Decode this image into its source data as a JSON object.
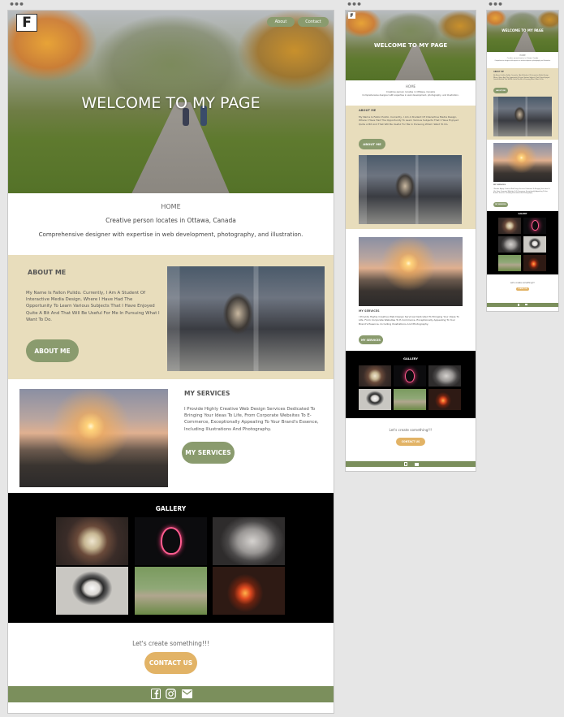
{
  "site": {
    "logo_letter": "F",
    "hero_title": "WELCOME TO MY PAGE",
    "nav": [
      {
        "label": "About"
      },
      {
        "label": "Contact"
      }
    ],
    "home": {
      "label": "HOME",
      "line1": "Creative person locates in Ottawa, Canada",
      "line2": "Comprehensive designer with expertise in web development, photography, and illustration."
    },
    "about": {
      "heading": "ABOUT ME",
      "body": "My Name Is Fallon Pulido. Currently, I Am A Student Of Interactive Media Design, Where I Have Had The Opportunity To Learn Various Subjects That I Have Enjoyed Quite A Bit And That Will Be Useful For Me In Pursuing What I Want To Do.",
      "button": "ABOUT ME"
    },
    "services": {
      "heading": "MY SERVICES",
      "body": "I Provide Highly Creative Web Design Services Dedicated To Bringing Your Ideas To Life, From Corporate Websites To E-Commerce, Exceptionally Appealing To Your Brand's Essence, Including Illustrations And Photography.",
      "button": "MY SERVICES"
    },
    "gallery": {
      "heading": "GALLERY"
    },
    "contact": {
      "tagline": "Let's create something!!!",
      "button": "CONTACT US"
    },
    "footer_icons": [
      "facebook-icon",
      "instagram-icon",
      "mail-icon"
    ]
  },
  "colors": {
    "accent_green": "#8a9b6e",
    "about_bg": "#e8ddbc",
    "contact_button": "#e2b366",
    "footer_green": "#7b8f5c",
    "canvas_bg": "#e6e6e6"
  }
}
